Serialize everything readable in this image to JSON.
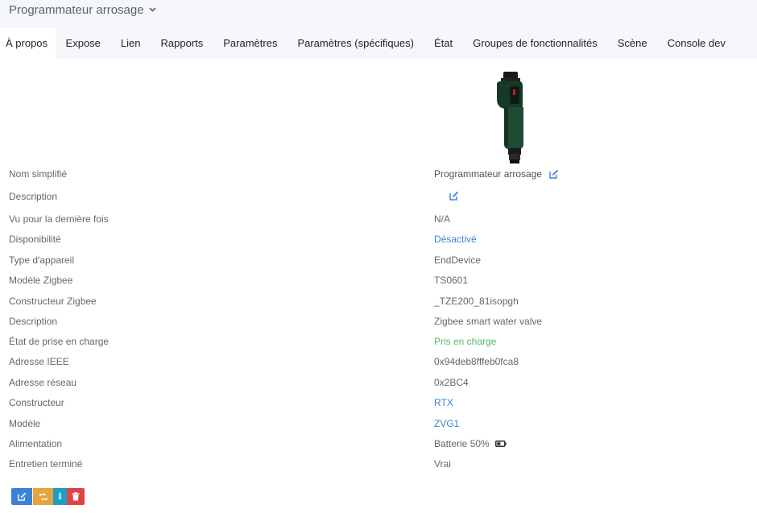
{
  "header": {
    "device_title": "Programmateur arrosage",
    "title_icon": "chevron-down-icon"
  },
  "tabs": [
    {
      "label": "À propos",
      "active": true
    },
    {
      "label": "Expose"
    },
    {
      "label": "Lien"
    },
    {
      "label": "Rapports"
    },
    {
      "label": "Paramètres"
    },
    {
      "label": "Paramètres (spécifiques)"
    },
    {
      "label": "État"
    },
    {
      "label": "Groupes de fonctionnalités"
    },
    {
      "label": "Scène"
    },
    {
      "label": "Console dev"
    }
  ],
  "details": {
    "friendly_name": {
      "label": "Nom simplifié",
      "value": "Programmateur arrosage"
    },
    "description_editable": {
      "label": "Description",
      "value": ""
    },
    "last_seen": {
      "label": "Vu pour la dernière fois",
      "value": "N/A"
    },
    "availability": {
      "label": "Disponibilité",
      "value": "Désactivé"
    },
    "device_type": {
      "label": "Type d'appareil",
      "value": "EndDevice"
    },
    "zigbee_model": {
      "label": "Modèle Zigbee",
      "value": "TS0601"
    },
    "zigbee_manufacturer": {
      "label": "Constructeur Zigbee",
      "value": "_TZE200_81isopgh"
    },
    "description": {
      "label": "Description",
      "value": "Zigbee smart water valve"
    },
    "support_status": {
      "label": "État de prise en charge",
      "value": "Pris en charge"
    },
    "ieee_address": {
      "label": "Adresse IEEE",
      "value": "0x94deb8fffeb0fca8"
    },
    "network_address": {
      "label": "Adresse réseau",
      "value": "0x2BC4"
    },
    "manufacturer": {
      "label": "Constructeur",
      "value": "RTX"
    },
    "model": {
      "label": "Modèle",
      "value": "ZVG1"
    },
    "power": {
      "label": "Alimentation",
      "value": "Batterie 50%",
      "battery_level": 0.5
    },
    "interview_completed": {
      "label": "Entretien terminé",
      "value": "Vrai"
    }
  },
  "colors": {
    "link": "#3b82d6",
    "success": "#54b868",
    "edit_button": "#3b82d6",
    "rename_button": "#e8a33d",
    "info_button": "#1e9ec7",
    "delete_button": "#dc4545"
  },
  "actions": {
    "edit_icon": "edit-icon",
    "rename_icon": "rename-icon",
    "info_icon": "info-icon",
    "delete_icon": "trash-icon",
    "info_glyph": "i"
  }
}
